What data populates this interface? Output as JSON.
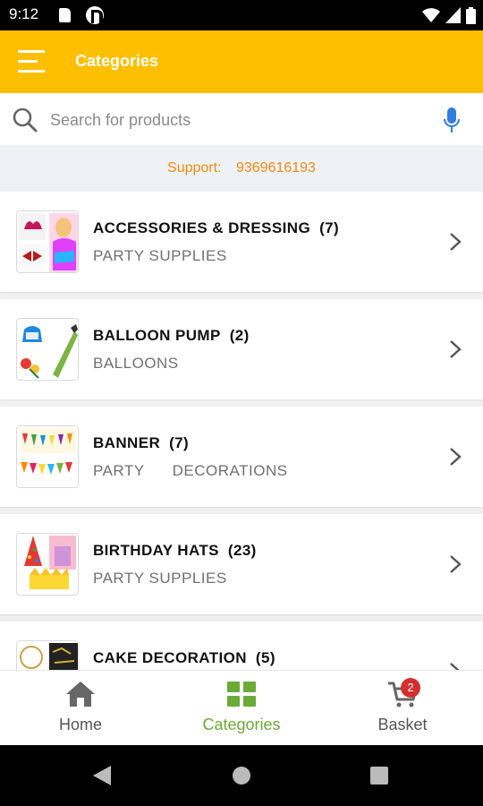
{
  "status_bar": {
    "time": "9:12"
  },
  "app_bar": {
    "title": "Categories",
    "menu_icon": "hamburger-menu-icon"
  },
  "search": {
    "placeholder": "Search for products",
    "search_icon": "search-icon",
    "mic_icon": "microphone-icon"
  },
  "support": {
    "label": "Support:",
    "phone": "9369616193"
  },
  "categories": [
    {
      "name": "ACCESSORIES & DRESSING",
      "count": "(7)",
      "subtitle": "PARTY SUPPLIES"
    },
    {
      "name": "BALLOON PUMP",
      "count": "(2)",
      "subtitle": "BALLOONS"
    },
    {
      "name": "BANNER",
      "count": "(7)",
      "subtitle": "PARTY      DECORATIONS"
    },
    {
      "name": "BIRTHDAY HATS",
      "count": "(23)",
      "subtitle": "PARTY SUPPLIES"
    },
    {
      "name": "CAKE DECORATION",
      "count": "(5)",
      "subtitle": ""
    }
  ],
  "bottom_nav": {
    "items": [
      {
        "label": "Home",
        "icon": "home-icon"
      },
      {
        "label": "Categories",
        "icon": "grid-icon",
        "active": true
      },
      {
        "label": "Basket",
        "icon": "cart-icon",
        "badge": "2"
      }
    ]
  },
  "colors": {
    "primary": "#fdbf00",
    "accent_orange": "#f2890c",
    "active_green": "#6aaa36",
    "badge_red": "#d32f2f"
  }
}
